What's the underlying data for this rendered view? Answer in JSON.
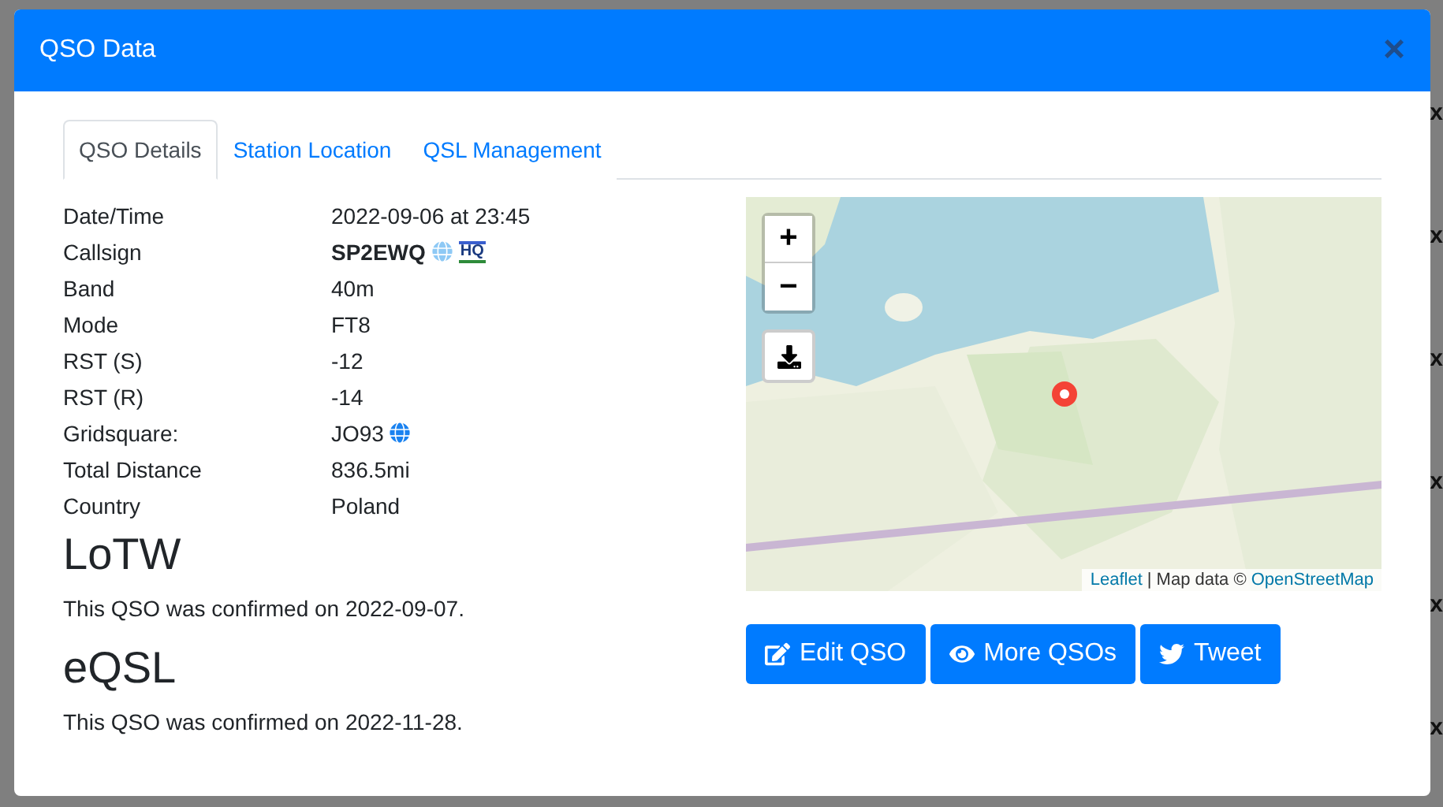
{
  "window": {
    "title": "QSO Data",
    "close": "×"
  },
  "backdrop": {
    "marks": [
      "x",
      "x",
      "x",
      "x",
      "x",
      "x"
    ]
  },
  "tabs": [
    {
      "label": "QSO Details",
      "selected": true
    },
    {
      "label": "Station Location",
      "selected": false
    },
    {
      "label": "QSL Management",
      "selected": false
    }
  ],
  "details": [
    {
      "label": "Date/Time",
      "value": "2022-09-06 at 23:45",
      "kind": "plain"
    },
    {
      "label": "Callsign",
      "value": "SP2EWQ",
      "kind": "callsign",
      "badge": "HQ"
    },
    {
      "label": "Band",
      "value": "40m",
      "kind": "plain"
    },
    {
      "label": "Mode",
      "value": "FT8",
      "kind": "plain"
    },
    {
      "label": "RST (S)",
      "value": "-12",
      "kind": "plain"
    },
    {
      "label": "RST (R)",
      "value": "-14",
      "kind": "plain"
    },
    {
      "label": "Gridsquare:",
      "value": "JO93",
      "kind": "grid"
    },
    {
      "label": "Total Distance",
      "value": "836.5mi",
      "kind": "plain"
    },
    {
      "label": "Country",
      "value": "Poland",
      "kind": "plain"
    }
  ],
  "sections": [
    {
      "heading": "LoTW",
      "text": "This QSO was confirmed on 2022-09-07."
    },
    {
      "heading": "eQSL",
      "text": "This QSO was confirmed on 2022-11-28."
    }
  ],
  "map": {
    "kind": "picture",
    "zoom_in": "+",
    "zoom_out": "−",
    "attribution": [
      {
        "text": "Leaflet",
        "link": true
      },
      {
        "text": "| Map data ©",
        "link": false
      },
      {
        "text": "OpenStreetMap",
        "link": true
      }
    ]
  },
  "buttons": [
    {
      "label": "Edit QSO",
      "kind": "edit"
    },
    {
      "label": "More QSOs",
      "kind": "view"
    },
    {
      "label": "Tweet",
      "kind": "share"
    }
  ]
}
